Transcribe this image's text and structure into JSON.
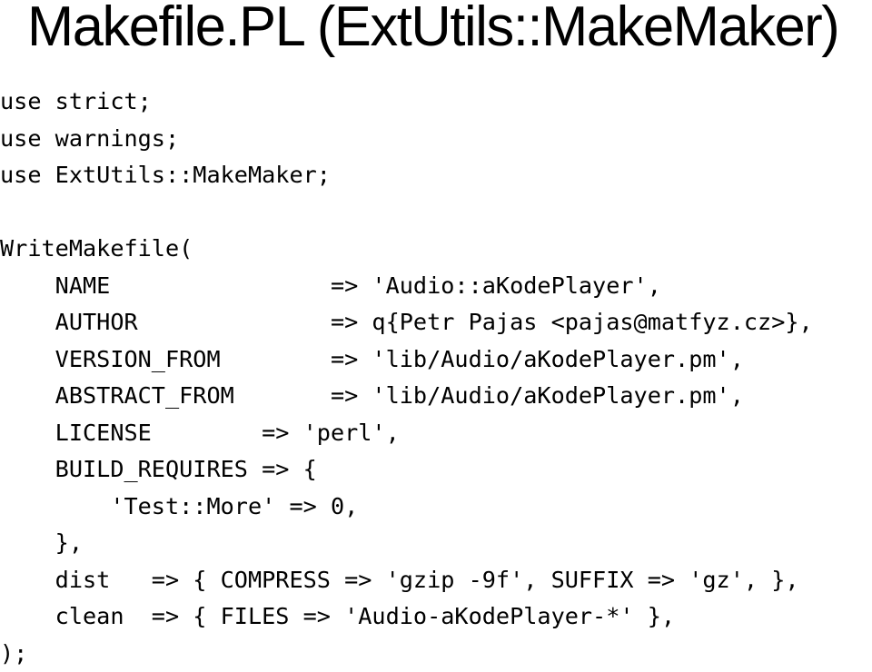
{
  "slide": {
    "title": "Makefile.PL (ExtUtils::MakeMaker)",
    "code_lines": [
      "use strict;",
      "use warnings;",
      "use ExtUtils::MakeMaker;",
      "",
      "WriteMakefile(",
      "    NAME                => 'Audio::aKodePlayer',",
      "    AUTHOR              => q{Petr Pajas <pajas@matfyz.cz>},",
      "    VERSION_FROM        => 'lib/Audio/aKodePlayer.pm',",
      "    ABSTRACT_FROM       => 'lib/Audio/aKodePlayer.pm',",
      "    LICENSE        => 'perl',",
      "    BUILD_REQUIRES => {",
      "        'Test::More' => 0,",
      "    },",
      "    dist   => { COMPRESS => 'gzip -9f', SUFFIX => 'gz', },",
      "    clean  => { FILES => 'Audio-aKodePlayer-*' },",
      ");"
    ]
  }
}
